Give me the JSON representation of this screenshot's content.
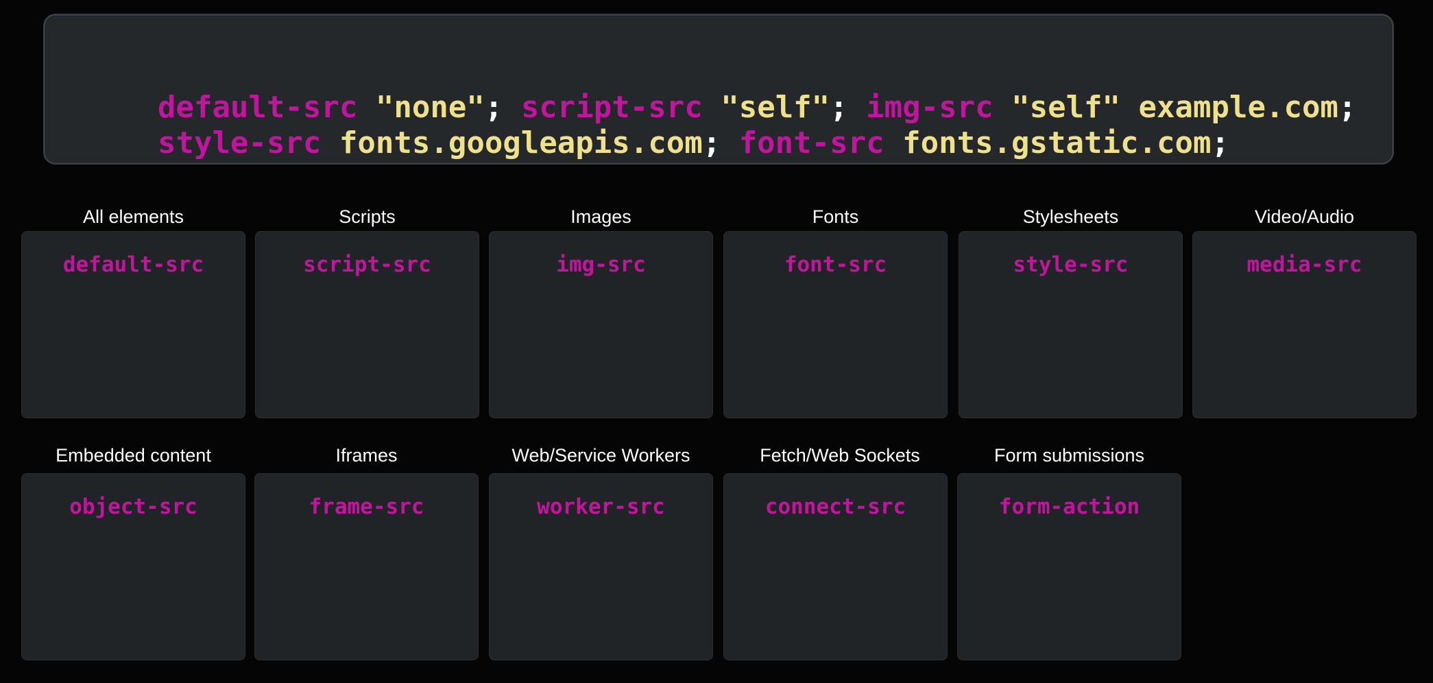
{
  "policy": {
    "line1": [
      {
        "text": "default-src",
        "kind": "directive"
      },
      {
        "text": " ",
        "kind": "punc"
      },
      {
        "text": "\"none\"",
        "kind": "value"
      },
      {
        "text": "; ",
        "kind": "punc"
      },
      {
        "text": "script-src",
        "kind": "directive"
      },
      {
        "text": " ",
        "kind": "punc"
      },
      {
        "text": "\"self\"",
        "kind": "value"
      },
      {
        "text": "; ",
        "kind": "punc"
      },
      {
        "text": "img-src",
        "kind": "directive"
      },
      {
        "text": " ",
        "kind": "punc"
      },
      {
        "text": "\"self\" example.com",
        "kind": "value"
      },
      {
        "text": ";",
        "kind": "punc"
      }
    ],
    "line2": [
      {
        "text": "style-src",
        "kind": "directive"
      },
      {
        "text": " ",
        "kind": "punc"
      },
      {
        "text": "fonts.googleapis.com",
        "kind": "value"
      },
      {
        "text": "; ",
        "kind": "punc"
      },
      {
        "text": "font-src",
        "kind": "directive"
      },
      {
        "text": " ",
        "kind": "punc"
      },
      {
        "text": "fonts.gstatic.com",
        "kind": "value"
      },
      {
        "text": ";",
        "kind": "punc"
      }
    ]
  },
  "colors": {
    "directive": "#c4139f",
    "value": "#efe08a",
    "punc": "#ffffff"
  },
  "cards": [
    {
      "label": "All elements",
      "directive": "default-src"
    },
    {
      "label": "Scripts",
      "directive": "script-src"
    },
    {
      "label": "Images",
      "directive": "img-src"
    },
    {
      "label": "Fonts",
      "directive": "font-src"
    },
    {
      "label": "Stylesheets",
      "directive": "style-src"
    },
    {
      "label": "Video/Audio",
      "directive": "media-src"
    },
    {
      "label": "Embedded content",
      "directive": "object-src"
    },
    {
      "label": "Iframes",
      "directive": "frame-src"
    },
    {
      "label": "Web/Service Workers",
      "directive": "worker-src"
    },
    {
      "label": "Fetch/Web Sockets",
      "directive": "connect-src"
    },
    {
      "label": "Form submissions",
      "directive": "form-action"
    }
  ]
}
